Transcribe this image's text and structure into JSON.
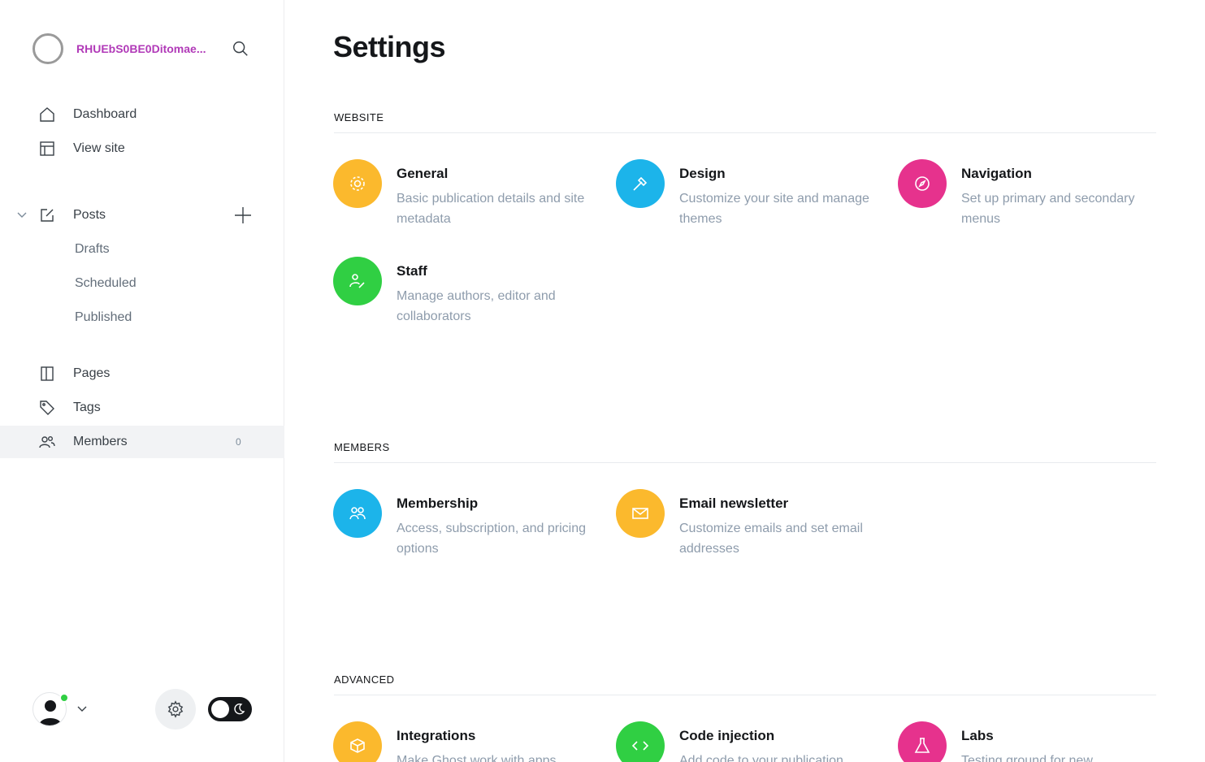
{
  "sidebar": {
    "site_title": "RHUEbS0BE0Ditomae...",
    "nav": {
      "dashboard": "Dashboard",
      "view_site": "View site",
      "posts": "Posts",
      "drafts": "Drafts",
      "scheduled": "Scheduled",
      "published": "Published",
      "pages": "Pages",
      "tags": "Tags",
      "members": "Members",
      "members_count": "0"
    }
  },
  "main": {
    "title": "Settings",
    "sections": {
      "website": {
        "heading": "WEBSITE",
        "cards": [
          {
            "title": "General",
            "desc": "Basic publication details and site metadata",
            "color": "#fbb92d",
            "icon": "gear-icon"
          },
          {
            "title": "Design",
            "desc": "Customize your site and manage themes",
            "color": "#1cb4ea",
            "icon": "brush-icon"
          },
          {
            "title": "Navigation",
            "desc": "Set up primary and secondary menus",
            "color": "#e6328d",
            "icon": "compass-icon"
          },
          {
            "title": "Staff",
            "desc": "Manage authors, editor and collaborators",
            "color": "#30cf43",
            "icon": "user-edit-icon"
          }
        ]
      },
      "members": {
        "heading": "MEMBERS",
        "cards": [
          {
            "title": "Membership",
            "desc": "Access, subscription, and pricing options",
            "color": "#1cb4ea",
            "icon": "members-icon"
          },
          {
            "title": "Email newsletter",
            "desc": "Customize emails and set email addresses",
            "color": "#fbb92d",
            "icon": "envelope-icon"
          }
        ]
      },
      "advanced": {
        "heading": "ADVANCED",
        "cards": [
          {
            "title": "Integrations",
            "desc": "Make Ghost work with apps",
            "color": "#fbb92d",
            "icon": "box-icon"
          },
          {
            "title": "Code injection",
            "desc": "Add code to your publication",
            "color": "#30cf43",
            "icon": "code-icon"
          },
          {
            "title": "Labs",
            "desc": "Testing ground for new",
            "color": "#e6328d",
            "icon": "flask-icon"
          }
        ]
      }
    }
  }
}
